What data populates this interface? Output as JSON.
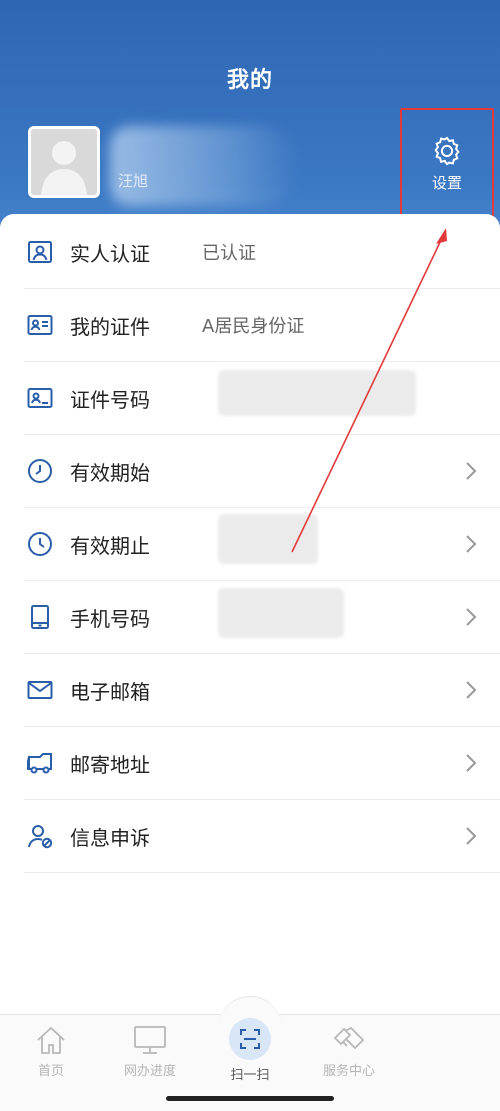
{
  "header": {
    "title": "我的",
    "username": "汪旭",
    "settings_label": "设置"
  },
  "profile_rows": [
    {
      "label": "实人认证",
      "value": "已认证",
      "icon": "person-card-icon",
      "chevron": false
    },
    {
      "label": "我的证件",
      "value": "A居民身份证",
      "icon": "id-card-icon",
      "chevron": false
    },
    {
      "label": "证件号码",
      "value": "",
      "icon": "id-number-icon",
      "chevron": false
    },
    {
      "label": "有效期始",
      "value": "",
      "icon": "clock-start-icon",
      "chevron": true
    },
    {
      "label": "有效期止",
      "value": "",
      "icon": "clock-end-icon",
      "chevron": true
    },
    {
      "label": "手机号码",
      "value": "",
      "icon": "phone-icon",
      "chevron": true
    },
    {
      "label": "电子邮箱",
      "value": "",
      "icon": "mail-icon",
      "chevron": true
    },
    {
      "label": "邮寄地址",
      "value": "",
      "icon": "truck-icon",
      "chevron": true
    },
    {
      "label": "信息申诉",
      "value": "",
      "icon": "appeal-icon",
      "chevron": true
    }
  ],
  "tabbar": [
    {
      "label": "首页",
      "icon": "home-icon"
    },
    {
      "label": "网办进度",
      "icon": "monitor-icon"
    },
    {
      "label": "扫一扫",
      "icon": "scan-icon"
    },
    {
      "label": "服务中心",
      "icon": "handshake-icon"
    }
  ],
  "colors": {
    "header_blue": "#2f66b3",
    "icon_blue": "#2a5ea8",
    "highlight_red": "#e23a3a"
  }
}
